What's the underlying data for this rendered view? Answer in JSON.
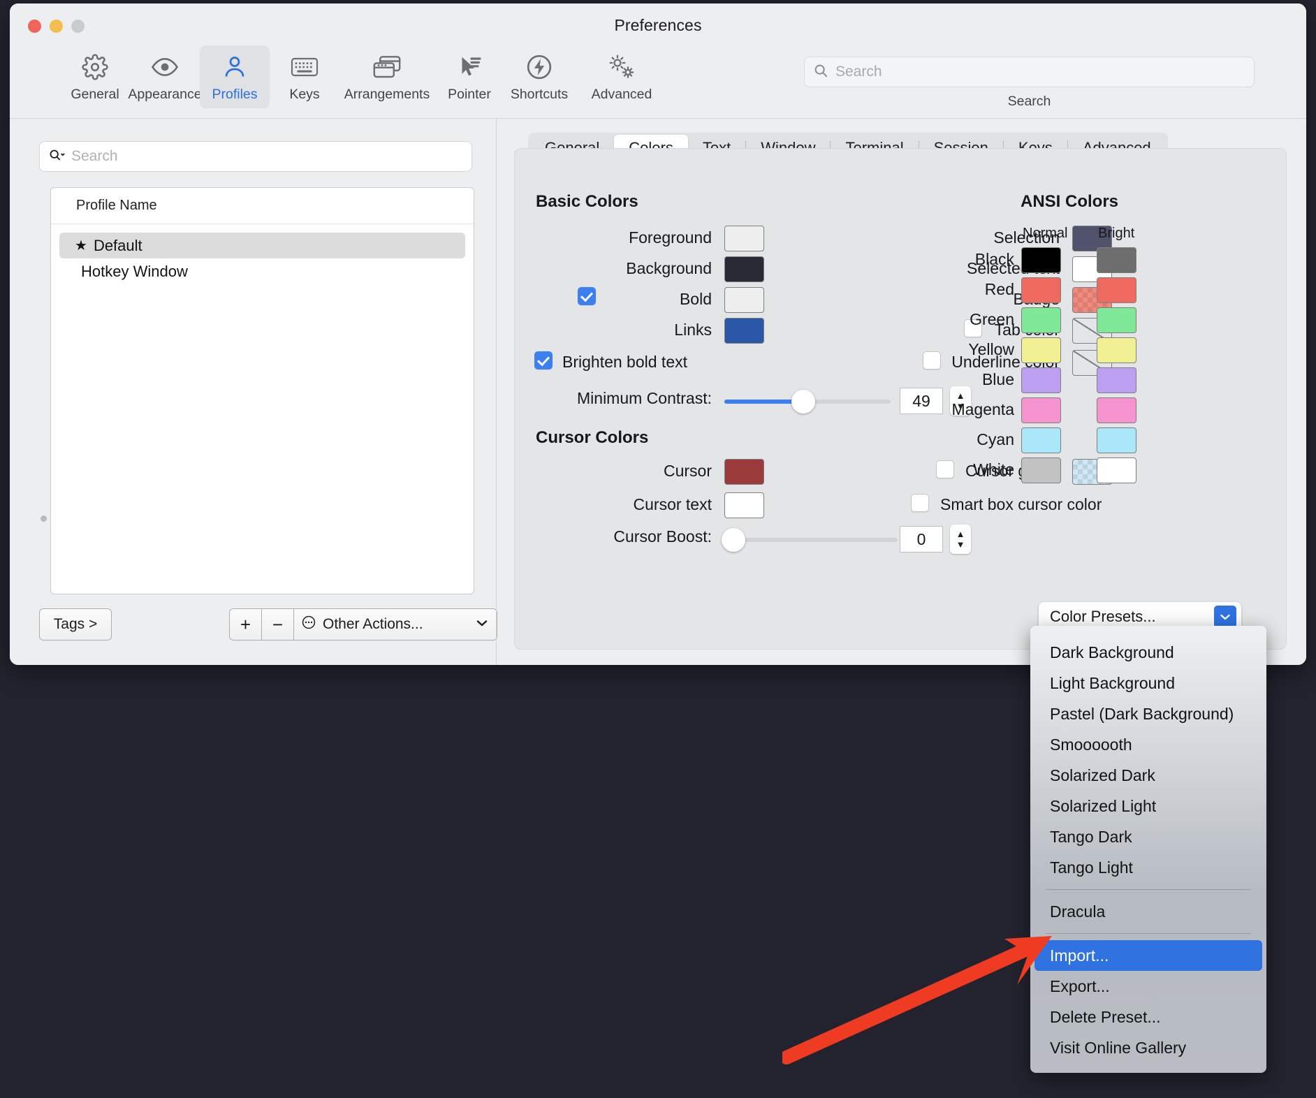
{
  "window": {
    "title": "Preferences",
    "traffic_lights": [
      "close-button",
      "minimize-button",
      "zoom-button"
    ]
  },
  "toolbar": {
    "items": [
      {
        "label": "General",
        "icon": "gear-icon",
        "selected": false
      },
      {
        "label": "Appearance",
        "icon": "eye-icon",
        "selected": false
      },
      {
        "label": "Profiles",
        "icon": "person-icon",
        "selected": true
      },
      {
        "label": "Keys",
        "icon": "keyboard-icon",
        "selected": false
      },
      {
        "label": "Arrangements",
        "icon": "windows-icon",
        "selected": false
      },
      {
        "label": "Pointer",
        "icon": "cursor-icon",
        "selected": false
      },
      {
        "label": "Shortcuts",
        "icon": "bolt-circle-icon",
        "selected": false
      },
      {
        "label": "Advanced",
        "icon": "gears-icon",
        "selected": false
      }
    ],
    "search": {
      "placeholder": "Search",
      "value": "",
      "caption": "Search",
      "icon": "search-icon"
    }
  },
  "sidebar": {
    "search": {
      "placeholder": "Search",
      "value": "",
      "icon": "search-chevron-icon"
    },
    "list_header": "Profile Name",
    "profiles": [
      {
        "name": "Default",
        "starred": true,
        "star": "★",
        "selected": true
      },
      {
        "name": "Hotkey Window",
        "starred": false,
        "star": "",
        "selected": false
      }
    ],
    "footer": {
      "tags_label": "Tags >",
      "add_label": "+",
      "remove_label": "−",
      "other_actions_label": "Other Actions...",
      "other_actions_icon": "ellipsis-circle-icon",
      "chevron": "⌄"
    }
  },
  "pane": {
    "tabs": [
      {
        "label": "General",
        "active": false
      },
      {
        "label": "Colors",
        "active": true
      },
      {
        "label": "Text",
        "active": false
      },
      {
        "label": "Window",
        "active": false
      },
      {
        "label": "Terminal",
        "active": false
      },
      {
        "label": "Session",
        "active": false
      },
      {
        "label": "Keys",
        "active": false
      },
      {
        "label": "Advanced",
        "active": false
      }
    ],
    "basic_colors": {
      "title": "Basic Colors",
      "left": [
        {
          "label": "Foreground",
          "color": "#eeeeee",
          "checkbox": null
        },
        {
          "label": "Background",
          "color": "#282a36",
          "checkbox": null
        },
        {
          "label": "Bold",
          "color": "#eeeeee",
          "checkbox": true
        },
        {
          "label": "Links",
          "color": "#2b57a8",
          "checkbox": null
        }
      ],
      "right": [
        {
          "label": "Selection",
          "color": "#50536b",
          "checkbox": null,
          "style": "solid"
        },
        {
          "label": "Selected text",
          "color": "#ffffff",
          "checkbox": null,
          "style": "solid"
        },
        {
          "label": "Badge",
          "color": "#f08a7e",
          "checkbox": null,
          "style": "checker"
        },
        {
          "label": "Tab color",
          "color": "",
          "checkbox": false,
          "style": "slash"
        },
        {
          "label": "Underline color",
          "color": "",
          "checkbox": false,
          "style": "slash"
        }
      ],
      "brighten_bold_text": {
        "label": "Brighten bold text",
        "checked": true
      },
      "minimum_contrast": {
        "label": "Minimum Contrast:",
        "value": "49",
        "percent": 49,
        "min": 0,
        "max": 100
      }
    },
    "cursor_colors": {
      "title": "Cursor Colors",
      "cursor": {
        "label": "Cursor",
        "color": "#9c3b3b"
      },
      "cursor_text": {
        "label": "Cursor text",
        "color": "#ffffff"
      },
      "cursor_guide": {
        "label": "Cursor guide",
        "checked": false,
        "color": "#cfe8f5",
        "style": "checker"
      },
      "smart_box_cursor_color": {
        "label": "Smart box cursor color",
        "checked": false
      },
      "cursor_boost": {
        "label": "Cursor Boost:",
        "value": "0",
        "percent": 0,
        "min": 0,
        "max": 100
      }
    },
    "ansi_colors": {
      "title": "ANSI Colors",
      "col_normal": "Normal",
      "col_bright": "Bright",
      "rows": [
        {
          "label": "Black",
          "normal": "#000000",
          "bright": "#6e6e6e"
        },
        {
          "label": "Red",
          "normal": "#ef6a5e",
          "bright": "#ef6a5e"
        },
        {
          "label": "Green",
          "normal": "#7ee896",
          "bright": "#7ee896"
        },
        {
          "label": "Yellow",
          "normal": "#f1f194",
          "bright": "#f1f194"
        },
        {
          "label": "Blue",
          "normal": "#bd9ff2",
          "bright": "#bd9ff2"
        },
        {
          "label": "Magenta",
          "normal": "#f493cd",
          "bright": "#f493cd"
        },
        {
          "label": "Cyan",
          "normal": "#a9e7f9",
          "bright": "#a9e7f9"
        },
        {
          "label": "White",
          "normal": "#c2c2c2",
          "bright": "#ffffff"
        }
      ]
    },
    "color_presets": {
      "button_label": "Color Presets...",
      "menu_items": [
        {
          "label": "Dark Background",
          "type": "item",
          "highlight": false
        },
        {
          "label": "Light Background",
          "type": "item",
          "highlight": false
        },
        {
          "label": "Pastel (Dark Background)",
          "type": "item",
          "highlight": false
        },
        {
          "label": "Smoooooth",
          "type": "item",
          "highlight": false
        },
        {
          "label": "Solarized Dark",
          "type": "item",
          "highlight": false
        },
        {
          "label": "Solarized Light",
          "type": "item",
          "highlight": false
        },
        {
          "label": "Tango Dark",
          "type": "item",
          "highlight": false
        },
        {
          "label": "Tango Light",
          "type": "item",
          "highlight": false
        },
        {
          "label": "",
          "type": "separator",
          "highlight": false
        },
        {
          "label": "Dracula",
          "type": "item",
          "highlight": false
        },
        {
          "label": "",
          "type": "separator",
          "highlight": false
        },
        {
          "label": "Import...",
          "type": "item",
          "highlight": true
        },
        {
          "label": "Export...",
          "type": "item",
          "highlight": false
        },
        {
          "label": "Delete Preset...",
          "type": "item",
          "highlight": false
        },
        {
          "label": "Visit Online Gallery",
          "type": "item",
          "highlight": false
        }
      ]
    }
  },
  "annotation": {
    "arrow_color": "#ef3b22",
    "points_at": "Import..."
  }
}
